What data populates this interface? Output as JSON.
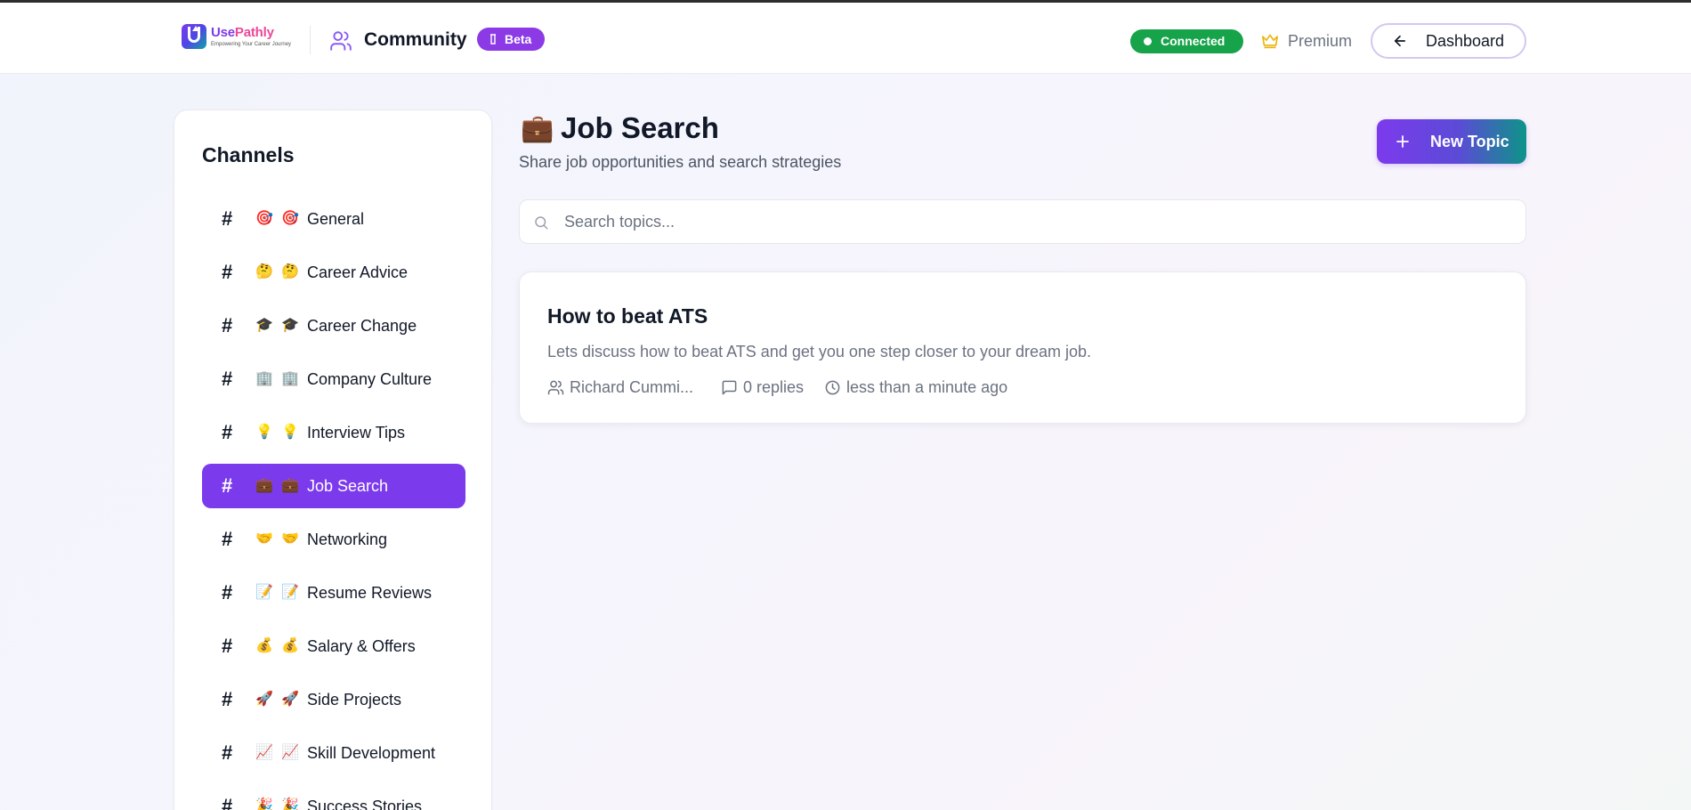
{
  "header": {
    "logo": {
      "name_part1": "Use",
      "name_part2": "Pathly",
      "tagline": "Empowering Your Career Journey"
    },
    "title": "Community",
    "beta_label": "Beta",
    "connection_status": "Connected",
    "premium_label": "Premium",
    "dashboard_label": "Dashboard"
  },
  "sidebar": {
    "title": "Channels",
    "channels": [
      {
        "emoji": "🎯",
        "label": "General",
        "active": false
      },
      {
        "emoji": "🤔",
        "label": "Career Advice",
        "active": false
      },
      {
        "emoji": "🎓",
        "label": "Career Change",
        "active": false
      },
      {
        "emoji": "🏢",
        "label": "Company Culture",
        "active": false
      },
      {
        "emoji": "💡",
        "label": "Interview Tips",
        "active": false
      },
      {
        "emoji": "💼",
        "label": "Job Search",
        "active": true
      },
      {
        "emoji": "🤝",
        "label": "Networking",
        "active": false
      },
      {
        "emoji": "📝",
        "label": "Resume Reviews",
        "active": false
      },
      {
        "emoji": "💰",
        "label": "Salary & Offers",
        "active": false
      },
      {
        "emoji": "🚀",
        "label": "Side Projects",
        "active": false
      },
      {
        "emoji": "📈",
        "label": "Skill Development",
        "active": false
      },
      {
        "emoji": "🎉",
        "label": "Success Stories",
        "active": false
      }
    ]
  },
  "main": {
    "channel_emoji": "💼",
    "channel_title": "Job Search",
    "channel_description": "Share job opportunities and search strategies",
    "new_topic_label": "New Topic",
    "search_placeholder": "Search topics...",
    "topics": [
      {
        "title": "How to beat ATS",
        "description": "Lets discuss how to beat ATS and get you one step closer to your dream job.",
        "author": "Richard Cummi...",
        "replies": "0 replies",
        "time": "less than a minute ago"
      }
    ]
  },
  "colors": {
    "accent": "#7c3aed",
    "teal": "#0d9488",
    "connected": "#16a34a",
    "premium_crown": "#eab308"
  },
  "icons": {
    "header_community": "users-icon",
    "beta": "flask-icon",
    "premium": "crown-icon",
    "dashboard": "arrow-left-icon",
    "new_topic": "plus-icon",
    "search": "search-icon",
    "author": "users-icon",
    "replies": "message-square-icon",
    "time": "clock-icon"
  }
}
